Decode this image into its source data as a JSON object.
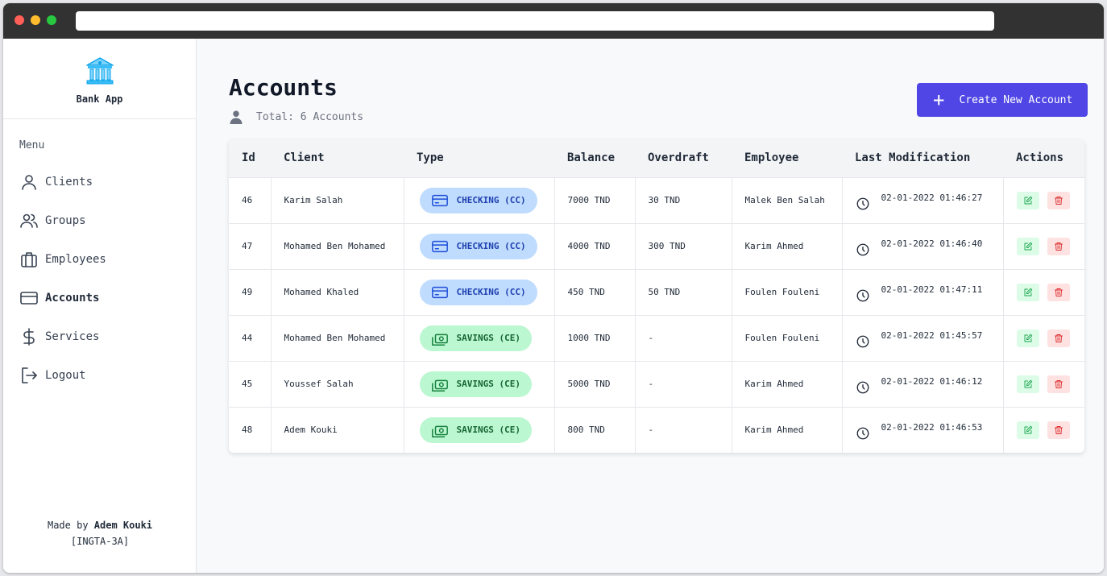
{
  "brand": {
    "name": "Bank App"
  },
  "sidebar": {
    "menu_title": "Menu",
    "items": [
      {
        "label": "Clients",
        "icon": "user-icon"
      },
      {
        "label": "Groups",
        "icon": "users-icon"
      },
      {
        "label": "Employees",
        "icon": "briefcase-icon"
      },
      {
        "label": "Accounts",
        "icon": "credit-card-icon",
        "active": true
      },
      {
        "label": "Services",
        "icon": "dollar-icon"
      },
      {
        "label": "Logout",
        "icon": "logout-icon"
      }
    ],
    "credit_prefix": "Made by",
    "credit_name": "Adem Kouki",
    "credit_group": "[INGTA-3A]"
  },
  "page": {
    "title": "Accounts",
    "total": "Total: 6 Accounts",
    "create_button": "Create New Account"
  },
  "table": {
    "headers": [
      "Id",
      "Client",
      "Type",
      "Balance",
      "Overdraft",
      "Employee",
      "Last Modification",
      "Actions"
    ],
    "rows": [
      {
        "id": "46",
        "client": "Karim Salah",
        "type": "CHECKING (CC)",
        "kind": "checking",
        "balance": "7000 TND",
        "overdraft": "30 TND",
        "employee": "Malek Ben Salah",
        "modified": "02-01-2022 01:46:27"
      },
      {
        "id": "47",
        "client": "Mohamed Ben Mohamed",
        "type": "CHECKING (CC)",
        "kind": "checking",
        "balance": "4000 TND",
        "overdraft": "300 TND",
        "employee": "Karim Ahmed",
        "modified": "02-01-2022 01:46:40"
      },
      {
        "id": "49",
        "client": "Mohamed Khaled",
        "type": "CHECKING (CC)",
        "kind": "checking",
        "balance": "450 TND",
        "overdraft": "50 TND",
        "employee": "Foulen Fouleni",
        "modified": "02-01-2022 01:47:11"
      },
      {
        "id": "44",
        "client": "Mohamed Ben Mohamed",
        "type": "SAVINGS (CE)",
        "kind": "savings",
        "balance": "1000 TND",
        "overdraft": "-",
        "employee": "Foulen Fouleni",
        "modified": "02-01-2022 01:45:57"
      },
      {
        "id": "45",
        "client": "Youssef Salah",
        "type": "SAVINGS (CE)",
        "kind": "savings",
        "balance": "5000 TND",
        "overdraft": "-",
        "employee": "Karim Ahmed",
        "modified": "02-01-2022 01:46:12"
      },
      {
        "id": "48",
        "client": "Adem Kouki",
        "type": "SAVINGS (CE)",
        "kind": "savings",
        "balance": "800 TND",
        "overdraft": "-",
        "employee": "Karim Ahmed",
        "modified": "02-01-2022 01:46:53"
      }
    ]
  },
  "colors": {
    "accent": "#4f46e5",
    "checking_bg": "#bfdbfe",
    "savings_bg": "#bbf7d0",
    "edit_bg": "#dcfce7",
    "delete_bg": "#fee2e2"
  }
}
